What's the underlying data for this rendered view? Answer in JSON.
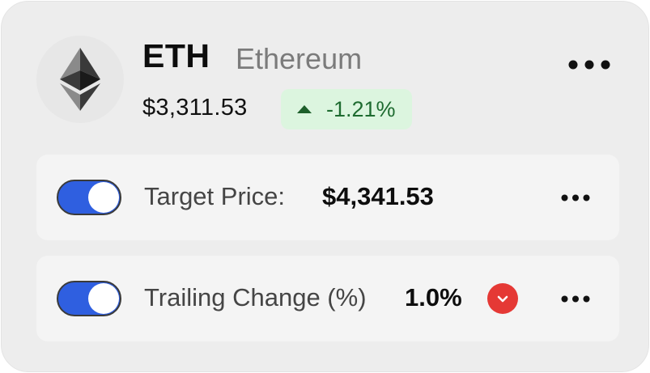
{
  "coin": {
    "symbol": "ETH",
    "name": "Ethereum",
    "price": "$3,311.53",
    "change": "-1.21%",
    "icon": "ethereum-icon"
  },
  "alerts": [
    {
      "enabled": true,
      "label": "Target Price:",
      "value": "$4,341.53"
    },
    {
      "enabled": true,
      "label": "Trailing Change (%)",
      "value": "1.0%"
    }
  ],
  "colors": {
    "accent": "#2f5fe0",
    "positive_bg": "#dcf5df",
    "positive_text": "#1e6b30",
    "danger": "#e53935"
  }
}
